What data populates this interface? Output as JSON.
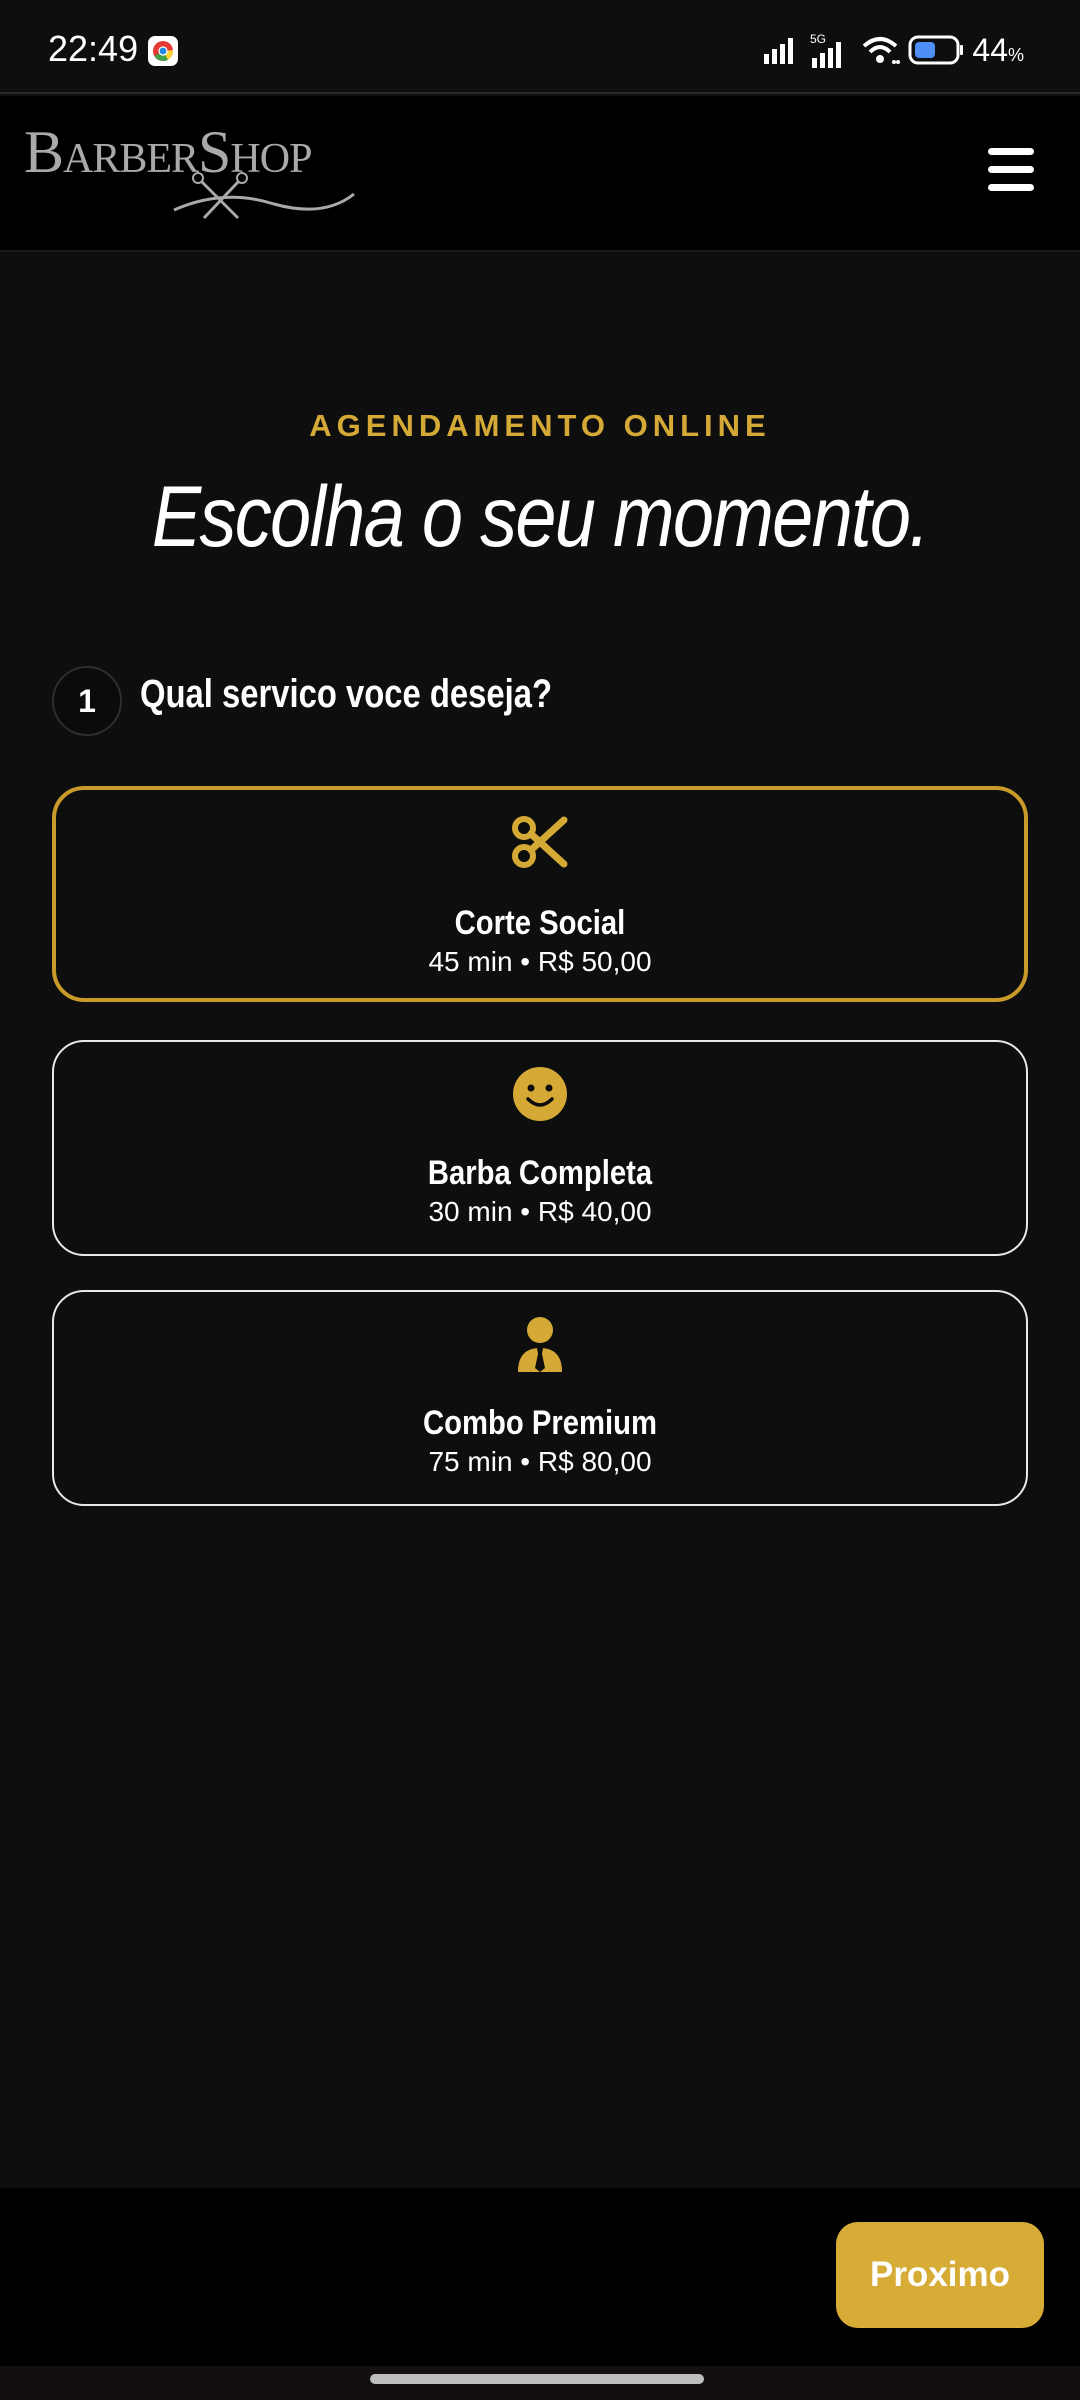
{
  "status_bar": {
    "time": "22:49",
    "network_label": "5G",
    "battery_percent": "44",
    "battery_unit": "%"
  },
  "header": {
    "logo_text": "BarberShop"
  },
  "main": {
    "overline": "AGENDAMENTO ONLINE",
    "title": "Escolha o seu momento.",
    "step": {
      "number": "1",
      "question": "Qual servico voce deseja?"
    },
    "services": [
      {
        "name": "Corte Social",
        "meta": "45 min • R$ 50,00",
        "icon": "scissors-icon",
        "selected": true
      },
      {
        "name": "Barba Completa",
        "meta": "30 min • R$ 40,00",
        "icon": "smile-icon",
        "selected": false
      },
      {
        "name": "Combo Premium",
        "meta": "75 min • R$ 80,00",
        "icon": "user-tie-icon",
        "selected": false
      }
    ]
  },
  "footer": {
    "next_label": "Proximo"
  },
  "colors": {
    "accent": "#d4a936",
    "background": "#0e0e0e",
    "header_bg": "#000000",
    "card_border": "#e8e8e8",
    "selected_border": "#c99a2a"
  }
}
